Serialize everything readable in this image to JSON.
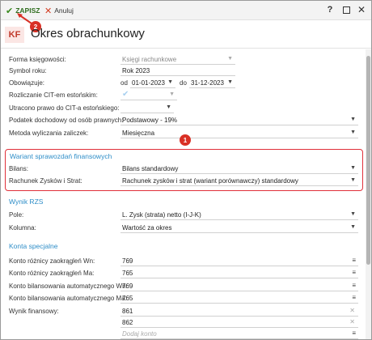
{
  "toolbar": {
    "save_label": "ZAPISZ",
    "cancel_label": "Anuluj"
  },
  "window_controls": {
    "help": "?",
    "close": "✕"
  },
  "callouts": {
    "one": "1",
    "two": "2"
  },
  "header": {
    "logo": "KF",
    "title": "Okres obrachunkowy"
  },
  "form": {
    "forma_label": "Forma księgowości:",
    "forma_value": "Księgi rachunkowe",
    "symbol_label": "Symbol roku:",
    "symbol_value": "Rok 2023",
    "obowiazuje_label": "Obowiązuje:",
    "od_label": "od",
    "od_value": "01-01-2023",
    "do_label": "do",
    "do_value": "31-12-2023",
    "cit_label": "Rozliczanie CIT-em estońskim:",
    "utracono_label": "Utracono prawo do CIT-a estońskiego:",
    "podatek_label": "Podatek dochodowy od osób prawnych:",
    "podatek_value": "Podstawowy - 19%",
    "metoda_label": "Metoda wyliczania zaliczek:",
    "metoda_value": "Miesięczna"
  },
  "wariant": {
    "title": "Wariant sprawozdań finansowych",
    "bilans_label": "Bilans:",
    "bilans_value": "Bilans standardowy",
    "rzis_label": "Rachunek Zysków i Strat:",
    "rzis_value": "Rachunek zysków i strat (wariant porównawczy) standardowy"
  },
  "wynik_rzs": {
    "title": "Wynik RZS",
    "pole_label": "Pole:",
    "pole_value": "L. Zysk (strata) netto (I-J-K)",
    "kolumna_label": "Kolumna:",
    "kolumna_value": "Wartość za okres"
  },
  "konta": {
    "title": "Konta specjalne",
    "roznicy_wn_label": "Konto różnicy zaokrągleń Wn:",
    "roznicy_wn_value": "769",
    "roznicy_ma_label": "Konto różnicy zaokrągleń Ma:",
    "roznicy_ma_value": "765",
    "bilans_wn_label": "Konto bilansowania automatycznego Wn:",
    "bilans_wn_value": "769",
    "bilans_ma_label": "Konto bilansowania automatycznego Ma:",
    "bilans_ma_value": "765",
    "wynik_label": "Wynik finansowy:",
    "wynik_values": [
      "861",
      "862"
    ],
    "dodaj_placeholder": "Dodaj konto"
  },
  "icons": {
    "save": "check-icon",
    "cancel": "x-icon",
    "help": "question-icon",
    "maximize": "maximize-icon",
    "close": "close-icon",
    "dropdown": "chevron-down-icon",
    "menu": "menu-icon",
    "remove": "remove-icon",
    "checkbox": "checkbox-icon"
  },
  "colors": {
    "accent": "#2f8ec8",
    "highlight": "#e0303a",
    "save": "#3a8a1f",
    "cancel": "#d23a1f",
    "logo": "#c0392b"
  }
}
